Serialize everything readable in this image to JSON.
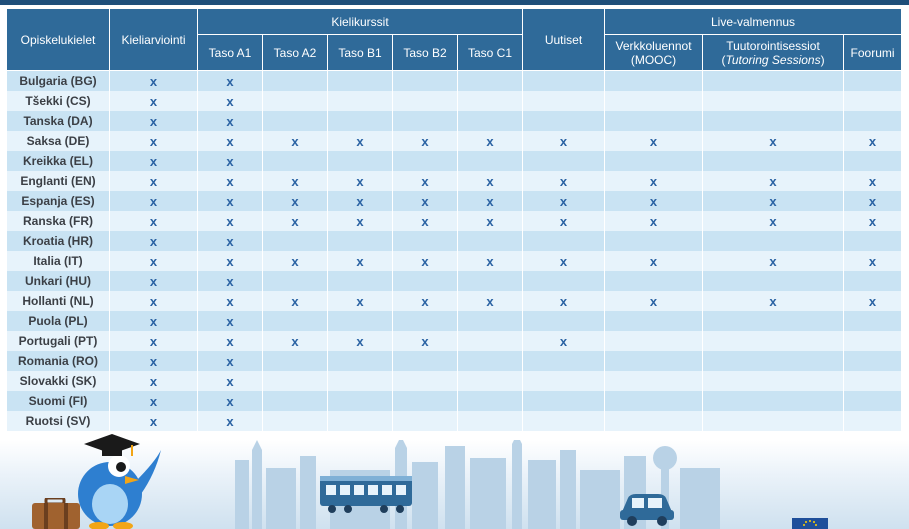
{
  "table": {
    "headers": {
      "languages": "Opiskelukielet",
      "assessment": "Kieliarviointi",
      "courses": "Kielikurssit",
      "levels": [
        "Taso A1",
        "Taso A2",
        "Taso B1",
        "Taso B2",
        "Taso C1"
      ],
      "news": "Uutiset",
      "live": "Live-valmennus",
      "mooc_line1": "Verkkoluennot",
      "mooc_line2": "(MOOC)",
      "tutoring_line1": "Tuutorointisessiot",
      "tutoring_line2": "Tutoring Sessions",
      "forum": "Foorumi"
    },
    "mark": "x",
    "rows": [
      {
        "lang": "Bulgaria (BG)",
        "marks": [
          1,
          1,
          0,
          0,
          0,
          0,
          0,
          0,
          0,
          0
        ]
      },
      {
        "lang": "Tšekki (CS)",
        "marks": [
          1,
          1,
          0,
          0,
          0,
          0,
          0,
          0,
          0,
          0
        ]
      },
      {
        "lang": "Tanska (DA)",
        "marks": [
          1,
          1,
          0,
          0,
          0,
          0,
          0,
          0,
          0,
          0
        ]
      },
      {
        "lang": "Saksa (DE)",
        "marks": [
          1,
          1,
          1,
          1,
          1,
          1,
          1,
          1,
          1,
          1
        ]
      },
      {
        "lang": "Kreikka (EL)",
        "marks": [
          1,
          1,
          0,
          0,
          0,
          0,
          0,
          0,
          0,
          0
        ]
      },
      {
        "lang": "Englanti (EN)",
        "marks": [
          1,
          1,
          1,
          1,
          1,
          1,
          1,
          1,
          1,
          1
        ]
      },
      {
        "lang": "Espanja (ES)",
        "marks": [
          1,
          1,
          1,
          1,
          1,
          1,
          1,
          1,
          1,
          1
        ]
      },
      {
        "lang": "Ranska (FR)",
        "marks": [
          1,
          1,
          1,
          1,
          1,
          1,
          1,
          1,
          1,
          1
        ]
      },
      {
        "lang": "Kroatia (HR)",
        "marks": [
          1,
          1,
          0,
          0,
          0,
          0,
          0,
          0,
          0,
          0
        ]
      },
      {
        "lang": "Italia (IT)",
        "marks": [
          1,
          1,
          1,
          1,
          1,
          1,
          1,
          1,
          1,
          1
        ]
      },
      {
        "lang": "Unkari (HU)",
        "marks": [
          1,
          1,
          0,
          0,
          0,
          0,
          0,
          0,
          0,
          0
        ]
      },
      {
        "lang": "Hollanti (NL)",
        "marks": [
          1,
          1,
          1,
          1,
          1,
          1,
          1,
          1,
          1,
          1
        ]
      },
      {
        "lang": "Puola (PL)",
        "marks": [
          1,
          1,
          0,
          0,
          0,
          0,
          0,
          0,
          0,
          0
        ]
      },
      {
        "lang": "Portugali (PT)",
        "marks": [
          1,
          1,
          1,
          1,
          1,
          0,
          1,
          0,
          0,
          0
        ]
      },
      {
        "lang": "Romania (RO)",
        "marks": [
          1,
          1,
          0,
          0,
          0,
          0,
          0,
          0,
          0,
          0
        ]
      },
      {
        "lang": "Slovakki (SK)",
        "marks": [
          1,
          1,
          0,
          0,
          0,
          0,
          0,
          0,
          0,
          0
        ]
      },
      {
        "lang": "Suomi (FI)",
        "marks": [
          1,
          1,
          0,
          0,
          0,
          0,
          0,
          0,
          0,
          0
        ]
      },
      {
        "lang": "Ruotsi (SV)",
        "marks": [
          1,
          1,
          0,
          0,
          0,
          0,
          0,
          0,
          0,
          0
        ]
      }
    ]
  },
  "colors": {
    "header": "#2f6a99",
    "row_dark": "#c9e3f3",
    "row_light": "#e7f3fb",
    "mark": "#2a62a3",
    "top_bar": "#1f4f7a"
  },
  "illustration": {
    "icons": [
      "mascot-bird-icon",
      "graduation-cap-icon",
      "suitcase-icon",
      "train-icon",
      "car-icon",
      "eu-flag-icon",
      "city-skyline-icon"
    ]
  }
}
